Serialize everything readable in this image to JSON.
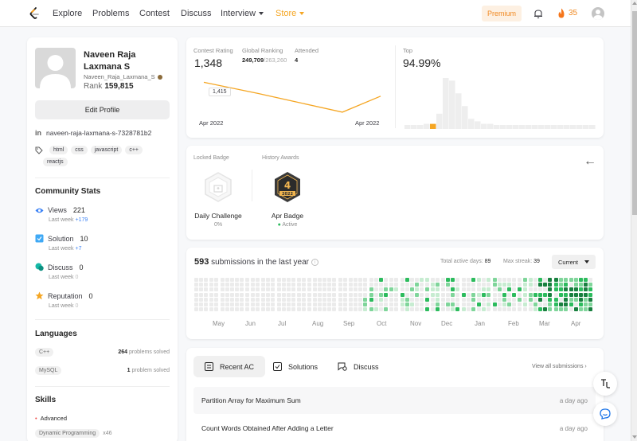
{
  "nav": {
    "items": [
      "Explore",
      "Problems",
      "Contest",
      "Discuss"
    ],
    "interview": "Interview",
    "store": "Store",
    "premium": "Premium",
    "streak": "35"
  },
  "profile": {
    "name": "Naveen Raja Laxmana S",
    "username": "Naveen_Raja_Laxmana_S",
    "rank_label": "Rank",
    "rank": "159,815",
    "edit_button": "Edit Profile",
    "linkedin": "naveen-raja-laxmana-s-7328781b2",
    "tags": [
      "html",
      "css",
      "javascript",
      "c++",
      "reactjs"
    ]
  },
  "community": {
    "title": "Community Stats",
    "items": [
      {
        "label": "Views",
        "value": "221",
        "sub": "Last week",
        "delta": "+179",
        "icon": "eye-icon",
        "color": "#3b82f6"
      },
      {
        "label": "Solution",
        "value": "10",
        "sub": "Last week",
        "delta": "+7",
        "icon": "solution-icon",
        "color": "#3fa9f5"
      },
      {
        "label": "Discuss",
        "value": "0",
        "sub": "Last week",
        "delta": "0",
        "icon": "discuss-icon",
        "color": "#15b8a6"
      },
      {
        "label": "Reputation",
        "value": "0",
        "sub": "Last week",
        "delta": "0",
        "icon": "star-icon",
        "color": "#f5a623"
      }
    ]
  },
  "languages": {
    "title": "Languages",
    "items": [
      {
        "name": "C++",
        "count": "264",
        "suffix": "problems solved"
      },
      {
        "name": "MySQL",
        "count": "1",
        "suffix": "problem solved"
      }
    ]
  },
  "skills": {
    "title": "Skills",
    "level": "Advanced",
    "items": [
      {
        "name": "Dynamic Programming",
        "count": "x46"
      }
    ]
  },
  "contest": {
    "rating_label": "Contest Rating",
    "rating": "1,348",
    "global_label": "Global Ranking",
    "global_rank": "249,709",
    "global_total": "/263,260",
    "attended_label": "Attended",
    "attended": "4",
    "top_label": "Top",
    "top": "94.99%",
    "tooltip": "1,415",
    "date_start": "Apr 2022",
    "date_end": "Apr 2022",
    "line_color": "#f5a623"
  },
  "chart_data": {
    "type": "line",
    "x": [
      "Apr 2022",
      "Apr 2022"
    ],
    "series": [
      {
        "values": [
          1415,
          1390,
          1348,
          1384
        ]
      }
    ],
    "distribution": {
      "type": "bar",
      "values": [
        1,
        1,
        1,
        2,
        2,
        6,
        20,
        19,
        14,
        9,
        4,
        3,
        2,
        2,
        1,
        1,
        1,
        1,
        1,
        1,
        1,
        1,
        1,
        1,
        1,
        1,
        1,
        1,
        1,
        1
      ],
      "highlight_index": 4
    }
  },
  "badges": {
    "locked_label": "Locked Badge",
    "history_label": "History Awards",
    "locked_name": "Daily Challenge",
    "locked_progress": "0%",
    "award_name": "Apr Badge",
    "award_status": "Active",
    "award_number": "4",
    "award_year": "2022"
  },
  "submissions": {
    "count": "593",
    "text": "submissions in the last year",
    "active_days_label": "Total active days:",
    "active_days": "89",
    "max_streak_label": "Max streak:",
    "max_streak": "39",
    "select": "Current",
    "months": [
      "May",
      "Jun",
      "Jul",
      "Aug",
      "Sep",
      "Oct",
      "Nov",
      "Dec",
      "Jan",
      "Feb",
      "Mar",
      "Apr"
    ]
  },
  "recent": {
    "tabs": [
      "Recent AC",
      "Solutions",
      "Discuss"
    ],
    "view_all": "View all submissions",
    "items": [
      {
        "title": "Partition Array for Maximum Sum",
        "time": "a day ago"
      },
      {
        "title": "Count Words Obtained After Adding a Letter",
        "time": "a day ago"
      }
    ]
  }
}
